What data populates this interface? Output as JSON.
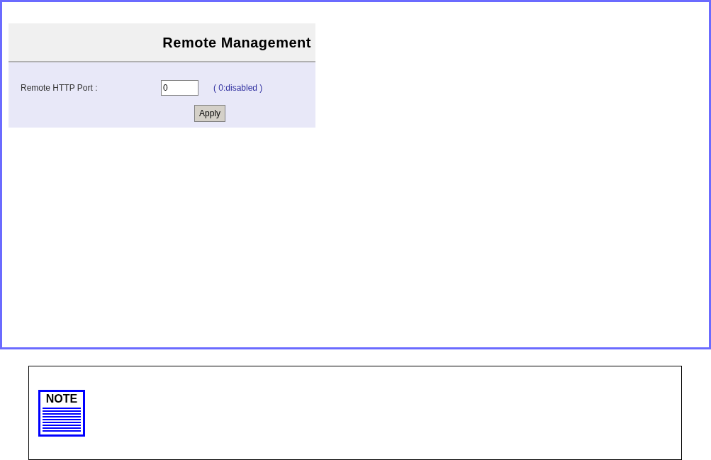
{
  "panel": {
    "title": "Remote Management",
    "fields": [
      {
        "label": "Remote HTTP Port :",
        "value": "0",
        "hint": "( 0:disabled )"
      }
    ],
    "button": "Apply"
  },
  "note": {
    "icon_label": "NOTE"
  }
}
